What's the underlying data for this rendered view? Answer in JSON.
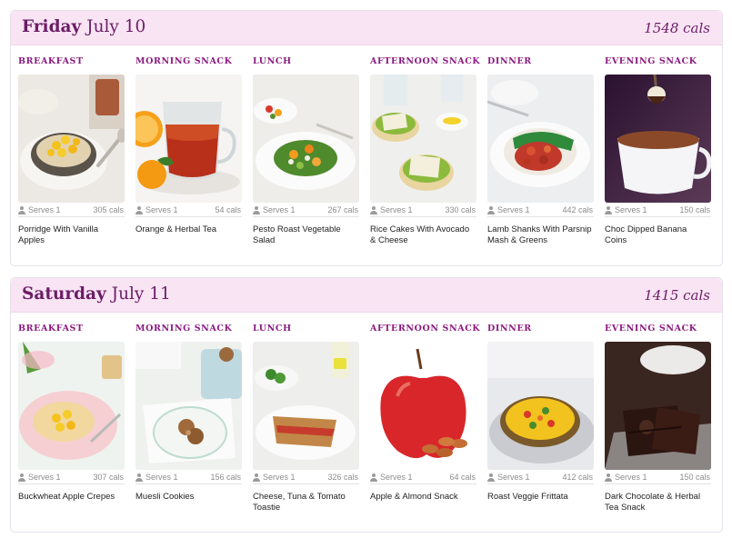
{
  "days": [
    {
      "day": "Friday",
      "date": "July 10",
      "total": "1548 cals",
      "meals": [
        {
          "type": "Breakfast",
          "serves": "Serves 1",
          "cals": "305 cals",
          "name": "Porridge With Vanilla Apples",
          "icon": "porridge-bowl-photo"
        },
        {
          "type": "Morning Snack",
          "serves": "Serves 1",
          "cals": "54 cals",
          "name": "Orange & Herbal Tea",
          "icon": "tea-cup-orange-photo"
        },
        {
          "type": "Lunch",
          "serves": "Serves 1",
          "cals": "267 cals",
          "name": "Pesto Roast Vegetable Salad",
          "icon": "salad-plate-photo"
        },
        {
          "type": "Afternoon Snack",
          "serves": "Serves 1",
          "cals": "330 cals",
          "name": "Rice Cakes With Avocado & Cheese",
          "icon": "rice-cakes-photo"
        },
        {
          "type": "Dinner",
          "serves": "Serves 1",
          "cals": "442 cals",
          "name": "Lamb Shanks With Parsnip Mash & Greens",
          "icon": "lamb-shanks-photo"
        },
        {
          "type": "Evening Snack",
          "serves": "Serves 1",
          "cals": "150 cals",
          "name": "Choc Dipped Banana Coins",
          "icon": "chocolate-cup-photo"
        }
      ]
    },
    {
      "day": "Saturday",
      "date": "July 11",
      "total": "1415 cals",
      "meals": [
        {
          "type": "Breakfast",
          "serves": "Serves 1",
          "cals": "307 cals",
          "name": "Buckwheat Apple Crepes",
          "icon": "crepes-plate-photo"
        },
        {
          "type": "Morning Snack",
          "serves": "Serves 1",
          "cals": "156 cals",
          "name": "Muesli Cookies",
          "icon": "muesli-cookies-photo"
        },
        {
          "type": "Lunch",
          "serves": "Serves 1",
          "cals": "326 cals",
          "name": "Cheese, Tuna & Tomato Toastie",
          "icon": "toastie-plate-photo"
        },
        {
          "type": "Afternoon Snack",
          "serves": "Serves 1",
          "cals": "64 cals",
          "name": "Apple & Almond Snack",
          "icon": "apple-almonds-photo"
        },
        {
          "type": "Dinner",
          "serves": "Serves 1",
          "cals": "412 cals",
          "name": "Roast Veggie Frittata",
          "icon": "frittata-pan-photo"
        },
        {
          "type": "Evening Snack",
          "serves": "Serves 1",
          "cals": "150 cals",
          "name": "Dark Chocolate & Herbal Tea Snack",
          "icon": "dark-chocolate-photo"
        }
      ]
    }
  ]
}
